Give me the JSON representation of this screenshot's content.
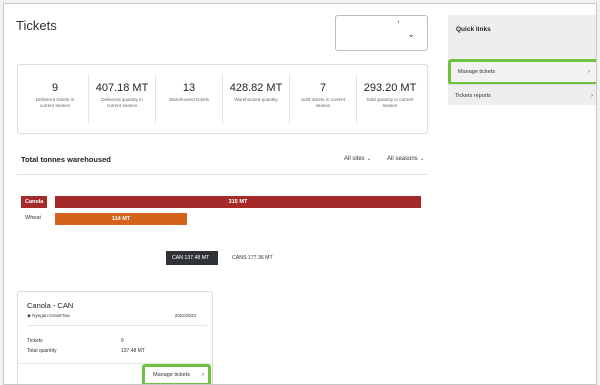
{
  "page": {
    "title": "Tickets"
  },
  "season_select": {
    "value": "",
    "chevron": "chevron-down-icon"
  },
  "stats": [
    {
      "value": "9",
      "label": "Delivered tickets in current season"
    },
    {
      "value": "407.18 MT",
      "label": "Delivered quantity in current season"
    },
    {
      "value": "13",
      "label": "Warehoused tickets"
    },
    {
      "value": "428.82 MT",
      "label": "Warehoused quantity"
    },
    {
      "value": "7",
      "label": "Sold tickets in current season"
    },
    {
      "value": "293.20 MT",
      "label": "Sold quantity in current season"
    }
  ],
  "warehoused": {
    "title": "Total tonnes warehoused",
    "filter_sites": "All sites",
    "filter_seasons": "All seasons",
    "colors": {
      "canola": "#a52a2a",
      "wheat": "#d4621c"
    }
  },
  "chart_data": {
    "type": "bar",
    "orientation": "horizontal",
    "categories": [
      "Canola",
      "Wheat"
    ],
    "values": [
      315,
      114
    ],
    "value_labels": [
      "315 MT",
      "114 MT"
    ],
    "unit": "MT",
    "title": "Total tonnes warehoused",
    "xlim": [
      0,
      315
    ]
  },
  "varieties": [
    {
      "label": "CAN 137.48 MT",
      "selected": true
    },
    {
      "label": "CANS 177.36 MT",
      "selected": false
    }
  ],
  "site_card": {
    "name": "Canola - CAN",
    "site": "Nyngan-GrainFlow",
    "season": "2022/2023",
    "rows": [
      {
        "label": "Tickets",
        "value": "6"
      },
      {
        "label": "Total quantity",
        "value": "137.48 MT"
      }
    ],
    "manage_label": "Manage tickets"
  },
  "quick_links": {
    "title": "Quick links",
    "items": [
      {
        "label": "Manage tickets"
      },
      {
        "label": "Tickets reports"
      }
    ],
    "highlight_color": "#6fc142"
  }
}
